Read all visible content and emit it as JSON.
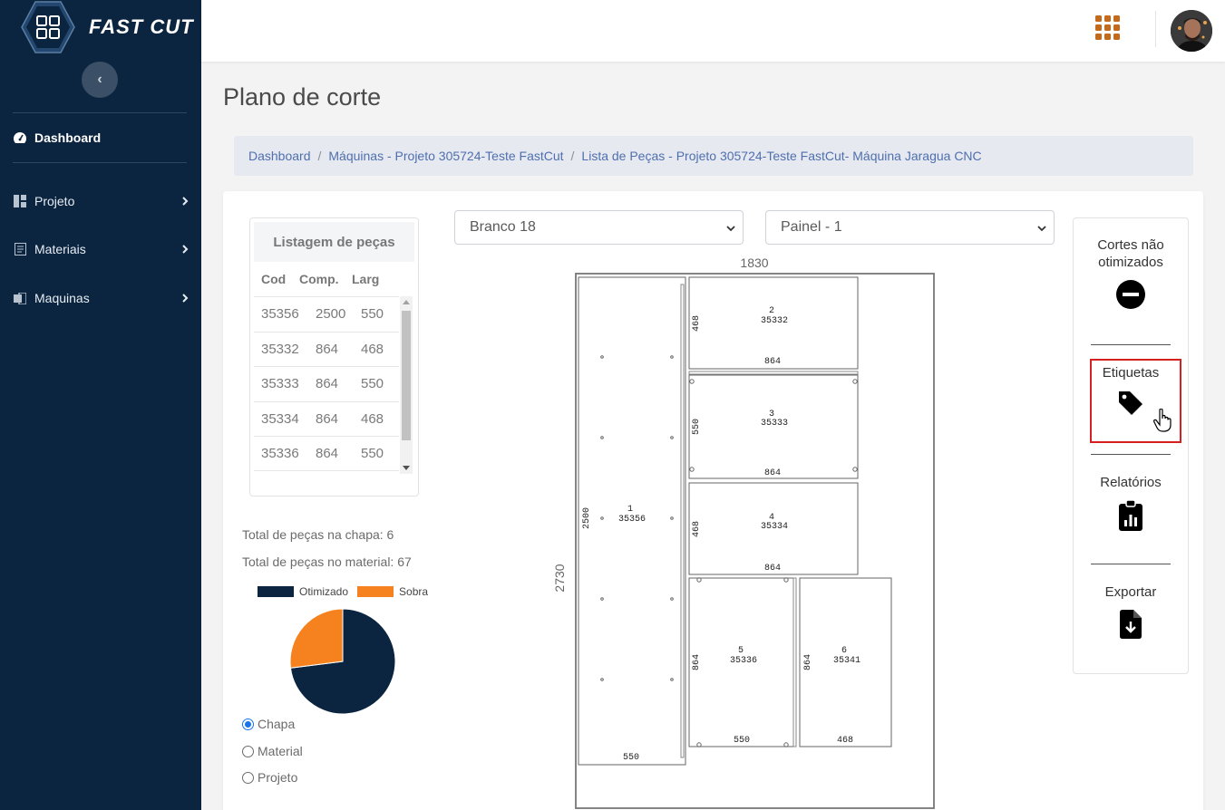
{
  "brand": {
    "name": "FAST CUT"
  },
  "sidebar": {
    "collapse_label": "‹",
    "items": [
      {
        "label": "Dashboard",
        "icon": "tachometer-icon"
      },
      {
        "label": "Projeto",
        "icon": "layout-icon"
      },
      {
        "label": "Materiais",
        "icon": "document-list-icon"
      },
      {
        "label": "Maquinas",
        "icon": "machine-icon"
      }
    ]
  },
  "header": {
    "page_title": "Plano de corte"
  },
  "breadcrumb": [
    "Dashboard",
    "Máquinas - Projeto 305724-Teste FastCut",
    "Lista de Peças - Projeto 305724-Teste FastCut- Máquina Jaragua CNC"
  ],
  "breadcrumb_separator": "/",
  "piece_list": {
    "title": "Listagem de peças",
    "columns": [
      "Cod",
      "Comp.",
      "Larg"
    ],
    "rows": [
      [
        "35356",
        "2500",
        "550"
      ],
      [
        "35332",
        "864",
        "468"
      ],
      [
        "35333",
        "864",
        "550"
      ],
      [
        "35334",
        "864",
        "468"
      ],
      [
        "35336",
        "864",
        "550"
      ]
    ]
  },
  "stats": {
    "pieces_on_sheet": "Total de peças na chapa: 6",
    "pieces_in_material": "Total de peças no material: 67"
  },
  "chart_data": {
    "type": "pie",
    "labels": [
      "Otimizado",
      "Sobra"
    ],
    "values": [
      73,
      27
    ],
    "colors": [
      "#0b2540",
      "#f5821f"
    ],
    "legend": "top"
  },
  "scope_options": [
    {
      "label": "Chapa",
      "checked": true
    },
    {
      "label": "Material",
      "checked": false
    },
    {
      "label": "Projeto",
      "checked": false
    }
  ],
  "selects": {
    "material": "Branco 18",
    "panel": "Painel - 1"
  },
  "plan": {
    "sheet_width_label": "1830",
    "sheet_height_label": "2730",
    "pieces": [
      {
        "num": "1",
        "code": "35356",
        "len": "2500",
        "wid": "550"
      },
      {
        "num": "2",
        "code": "35332",
        "len": "468",
        "wid": "864"
      },
      {
        "num": "3",
        "code": "35333",
        "len": "550",
        "wid": "864"
      },
      {
        "num": "4",
        "code": "35334",
        "len": "468",
        "wid": "864"
      },
      {
        "num": "5",
        "code": "35336",
        "len": "864",
        "wid": "550"
      },
      {
        "num": "6",
        "code": "35341",
        "len": "864",
        "wid": "468"
      }
    ]
  },
  "actions": [
    {
      "label": "Cortes não otimizados",
      "icon": "minus-circle-icon"
    },
    {
      "label": "Etiquetas",
      "icon": "tag-icon"
    },
    {
      "label": "Relatórios",
      "icon": "clipboard-chart-icon"
    },
    {
      "label": "Exportar",
      "icon": "file-download-icon"
    }
  ]
}
